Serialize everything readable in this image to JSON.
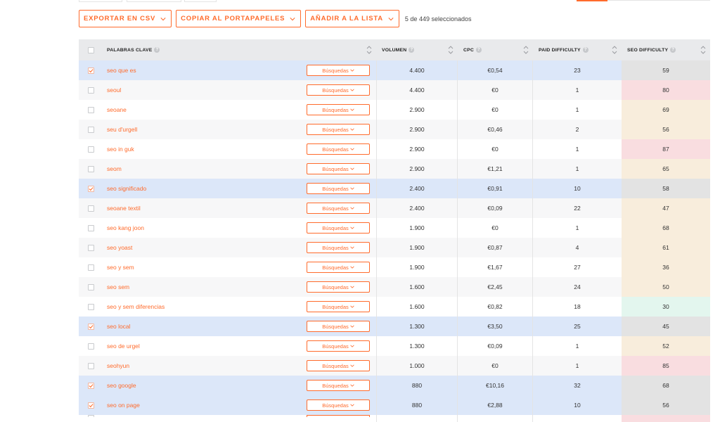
{
  "toolbar": {
    "export_csv": "EXPORTAR EN CSV",
    "copy_clipboard": "COPIAR AL PORTAPAPELES",
    "add_list": "AÑADIR A LA LISTA",
    "selected_count": "5 de 449 seleccionados"
  },
  "table": {
    "headers": {
      "keyword": "PALABRAS CLAVE",
      "volume": "VOLUMEN",
      "cpc": "CPC",
      "paid_difficulty": "PAID DIFFICULTY",
      "seo_difficulty": "SEO DIFFICULTY"
    },
    "search_label": "Búsquedas",
    "difficulty_colors": {
      "gray": "#e3e3e3",
      "pink": "#f9dde0",
      "peach": "#f8eddc",
      "green": "#e3f6ee"
    },
    "rows": [
      {
        "keyword": "seo que es",
        "volume": "4.400",
        "cpc": "€0,54",
        "paid": "23",
        "seo": "59",
        "checked": true,
        "color": "gray"
      },
      {
        "keyword": "seoul",
        "volume": "4.400",
        "cpc": "€0",
        "paid": "1",
        "seo": "80",
        "checked": false,
        "color": "pink"
      },
      {
        "keyword": "seoane",
        "volume": "2.900",
        "cpc": "€0",
        "paid": "1",
        "seo": "69",
        "checked": false,
        "color": "peach"
      },
      {
        "keyword": "seu d'urgell",
        "volume": "2.900",
        "cpc": "€0,46",
        "paid": "2",
        "seo": "56",
        "checked": false,
        "color": "peach"
      },
      {
        "keyword": "seo in guk",
        "volume": "2.900",
        "cpc": "€0",
        "paid": "1",
        "seo": "87",
        "checked": false,
        "color": "pink"
      },
      {
        "keyword": "seom",
        "volume": "2.900",
        "cpc": "€1,21",
        "paid": "1",
        "seo": "65",
        "checked": false,
        "color": "peach"
      },
      {
        "keyword": "seo significado",
        "volume": "2.400",
        "cpc": "€0,91",
        "paid": "10",
        "seo": "58",
        "checked": true,
        "color": "gray"
      },
      {
        "keyword": "seoane textil",
        "volume": "2.400",
        "cpc": "€0,09",
        "paid": "22",
        "seo": "47",
        "checked": false,
        "color": "peach"
      },
      {
        "keyword": "seo kang joon",
        "volume": "1.900",
        "cpc": "€0",
        "paid": "1",
        "seo": "68",
        "checked": false,
        "color": "peach"
      },
      {
        "keyword": "seo yoast",
        "volume": "1.900",
        "cpc": "€0,87",
        "paid": "4",
        "seo": "61",
        "checked": false,
        "color": "peach"
      },
      {
        "keyword": "seo y sem",
        "volume": "1.900",
        "cpc": "€1,67",
        "paid": "27",
        "seo": "36",
        "checked": false,
        "color": "peach"
      },
      {
        "keyword": "seo sem",
        "volume": "1.600",
        "cpc": "€2,45",
        "paid": "24",
        "seo": "50",
        "checked": false,
        "color": "peach"
      },
      {
        "keyword": "seo y sem diferencias",
        "volume": "1.600",
        "cpc": "€0,82",
        "paid": "18",
        "seo": "30",
        "checked": false,
        "color": "green"
      },
      {
        "keyword": "seo local",
        "volume": "1.300",
        "cpc": "€3,50",
        "paid": "25",
        "seo": "45",
        "checked": true,
        "color": "gray"
      },
      {
        "keyword": "seo de urgel",
        "volume": "1.300",
        "cpc": "€0,09",
        "paid": "1",
        "seo": "52",
        "checked": false,
        "color": "peach"
      },
      {
        "keyword": "seohyun",
        "volume": "1.000",
        "cpc": "€0",
        "paid": "1",
        "seo": "85",
        "checked": false,
        "color": "pink"
      },
      {
        "keyword": "seo google",
        "volume": "880",
        "cpc": "€10,16",
        "paid": "32",
        "seo": "68",
        "checked": true,
        "color": "gray"
      },
      {
        "keyword": "seo on page",
        "volume": "880",
        "cpc": "€2,88",
        "paid": "10",
        "seo": "56",
        "checked": true,
        "color": "gray"
      }
    ]
  }
}
